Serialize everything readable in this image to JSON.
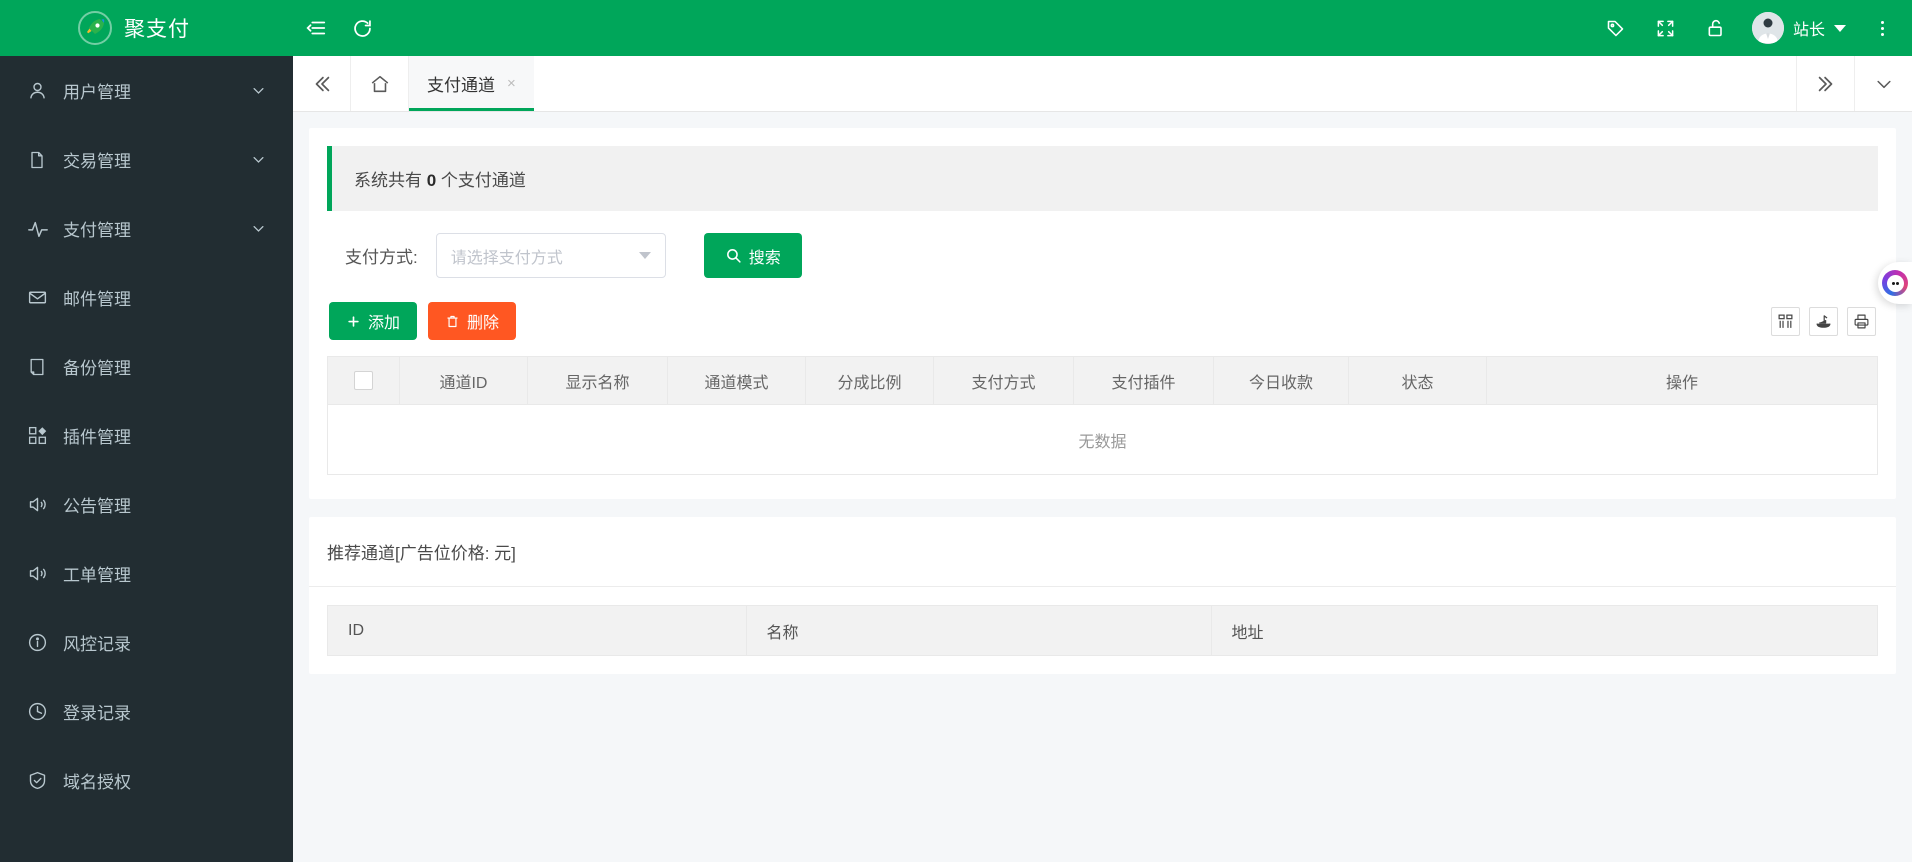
{
  "header": {
    "brand_name": "聚支付",
    "logo_icon": "rocket-icon",
    "menu_toggle_icon": "menu-fold-icon",
    "refresh_icon": "refresh-icon",
    "tag_icon": "tag-icon",
    "fullscreen_icon": "fullscreen-icon",
    "lock_icon": "unlock-icon",
    "user_name": "站长",
    "avatar_icon": "user-avatar",
    "more_icon": "more-vertical-icon"
  },
  "sidebar": {
    "items": [
      {
        "label": "用户管理",
        "icon": "user-icon",
        "has_arrow": true
      },
      {
        "label": "交易管理",
        "icon": "file-icon",
        "has_arrow": true
      },
      {
        "label": "支付管理",
        "icon": "activity-icon",
        "has_arrow": true
      },
      {
        "label": "邮件管理",
        "icon": "mail-icon",
        "has_arrow": false
      },
      {
        "label": "备份管理",
        "icon": "document-icon",
        "has_arrow": false
      },
      {
        "label": "插件管理",
        "icon": "grid-icon",
        "has_arrow": false
      },
      {
        "label": "公告管理",
        "icon": "speaker-icon",
        "has_arrow": false
      },
      {
        "label": "工单管理",
        "icon": "speaker-icon",
        "has_arrow": false
      },
      {
        "label": "风控记录",
        "icon": "info-circle-icon",
        "has_arrow": false
      },
      {
        "label": "登录记录",
        "icon": "clock-icon",
        "has_arrow": false
      },
      {
        "label": "域名授权",
        "icon": "shield-check-icon",
        "has_arrow": false
      }
    ]
  },
  "tabbar": {
    "collapse_icon": "double-chevron-left-icon",
    "home_icon": "home-icon",
    "expand_icon": "double-chevron-right-icon",
    "dropdown_icon": "chevron-down-icon",
    "tabs": [
      {
        "label": "支付通道",
        "active": true,
        "closable": true,
        "close_glyph": "×"
      }
    ]
  },
  "main": {
    "alert": {
      "prefix": "系统共有 ",
      "count": "0",
      "suffix": " 个支付通道",
      "accent_color": "#00a65a"
    },
    "search_form": {
      "label": "支付方式:",
      "select_value": "",
      "select_placeholder": "请选择支付方式",
      "search_button": "搜索",
      "search_icon": "search-icon"
    },
    "toolbar": {
      "add_label": "添加",
      "add_icon": "plus-icon",
      "delete_label": "删除",
      "delete_icon": "trash-icon",
      "right_icons": [
        "columns-icon",
        "export-icon",
        "print-icon"
      ]
    },
    "table": {
      "headers": [
        "",
        "通道ID",
        "显示名称",
        "通道模式",
        "分成比例",
        "支付方式",
        "支付插件",
        "今日收款",
        "状态",
        "操作"
      ],
      "rows": [],
      "empty_text": "无数据"
    },
    "recommend": {
      "title": "推荐通道[广告位价格: 元]",
      "headers": [
        "ID",
        "名称",
        "地址"
      ],
      "rows": []
    }
  },
  "float_widget": {
    "icon": "assistant-ball-icon"
  }
}
